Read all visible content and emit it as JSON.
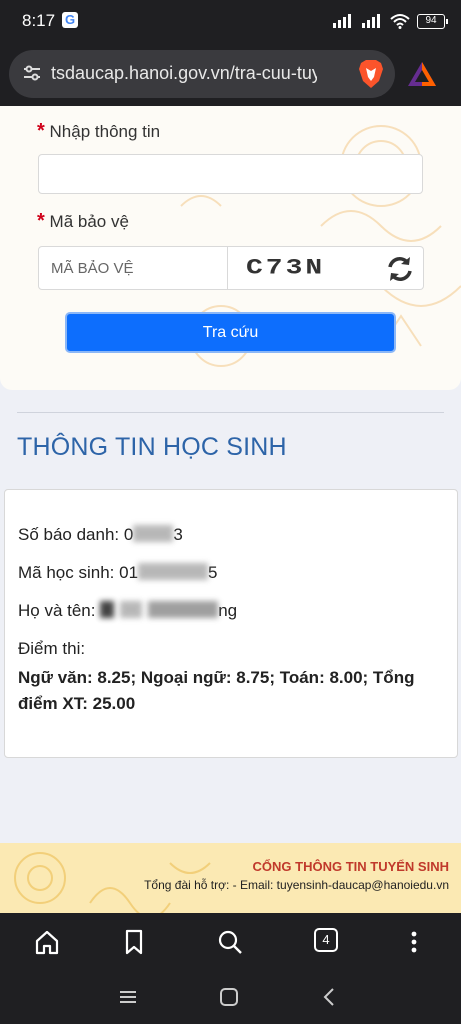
{
  "status_bar": {
    "time": "8:17",
    "battery": "94",
    "google_icon_letter": "G"
  },
  "browser": {
    "url": "tsdaucap.hanoi.gov.vn/tra-cuu-tuyen",
    "tab_count": "4"
  },
  "form": {
    "info_label": "Nhập thông tin",
    "info_value": "",
    "captcha_label": "Mã bảo vệ",
    "captcha_placeholder": "MÃ BẢO VỆ",
    "captcha_text": "C73N",
    "search_button": "Tra cứu"
  },
  "section": {
    "title": "THÔNG TIN HỌC SINH"
  },
  "student": {
    "sbd_label": "Số báo danh: ",
    "sbd_value_start": "0",
    "sbd_value_end": "3",
    "student_code_label": "Mã học sinh: ",
    "student_code_start": "01",
    "student_code_end": "5",
    "name_label": "Họ và tên: ",
    "name_end": "ng",
    "score_label": "Điểm thi:",
    "scores": "Ngữ văn: 8.25; Ngoại ngữ: 8.75; Toán: 8.00; Tổng điểm XT: 25.00"
  },
  "footer": {
    "title": "CỔNG THÔNG TIN TUYỂN SINH",
    "support": "Tổng đài hỗ trợ: - Email: tuyensinh-daucap@hanoiedu.vn"
  },
  "colors": {
    "accent": "#0d6efd",
    "title_blue": "#2d64a8",
    "footer_red": "#c0392b",
    "footer_bg": "#fbe9b3"
  }
}
